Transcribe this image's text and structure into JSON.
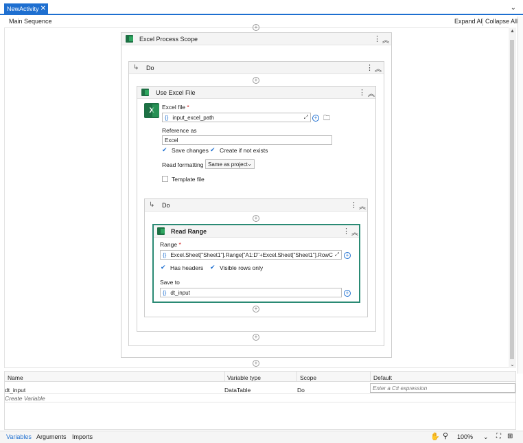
{
  "tab": {
    "title": "NewActivity",
    "close": "✕"
  },
  "breadcrumb": "Main Sequence",
  "header_actions": {
    "expand_all": "Expand All",
    "collapse_all": "Collapse All"
  },
  "excel_scope": {
    "title": "Excel Process Scope"
  },
  "do_outer": {
    "title": "Do"
  },
  "use_excel": {
    "title": "Use Excel File",
    "excel_file_label": "Excel file",
    "excel_file_value": "input_excel_path",
    "reference_label": "Reference as",
    "reference_value": "Excel",
    "save_changes": "Save changes",
    "create_if_not_exists": "Create if not exists",
    "read_formatting_label": "Read formatting",
    "read_formatting_value": "Same as project",
    "template_file": "Template file"
  },
  "do_inner": {
    "title": "Do"
  },
  "read_range": {
    "title": "Read Range",
    "range_label": "Range",
    "range_value": "Excel.Sheet[\"Sheet1\"].Range[\"A1:D\"+Excel.Sheet[\"Sheet1\"].RowC",
    "has_headers": "Has headers",
    "visible_rows_only": "Visible rows only",
    "save_to_label": "Save to",
    "save_to_value": "dt_input"
  },
  "variables": {
    "headers": [
      "Name",
      "Variable type",
      "Scope",
      "Default"
    ],
    "rows": [
      {
        "name": "dt_input",
        "type": "DataTable",
        "scope": "Do",
        "default_placeholder": "Enter a C# expression"
      }
    ],
    "create": "Create Variable"
  },
  "bottom_tabs": [
    "Variables",
    "Arguments",
    "Imports"
  ],
  "zoom": "100%",
  "required_mark": "*",
  "colors": {
    "accent": "#1e6fd0",
    "excel_green": "#1d7044",
    "selected_border": "#2a8a74"
  }
}
